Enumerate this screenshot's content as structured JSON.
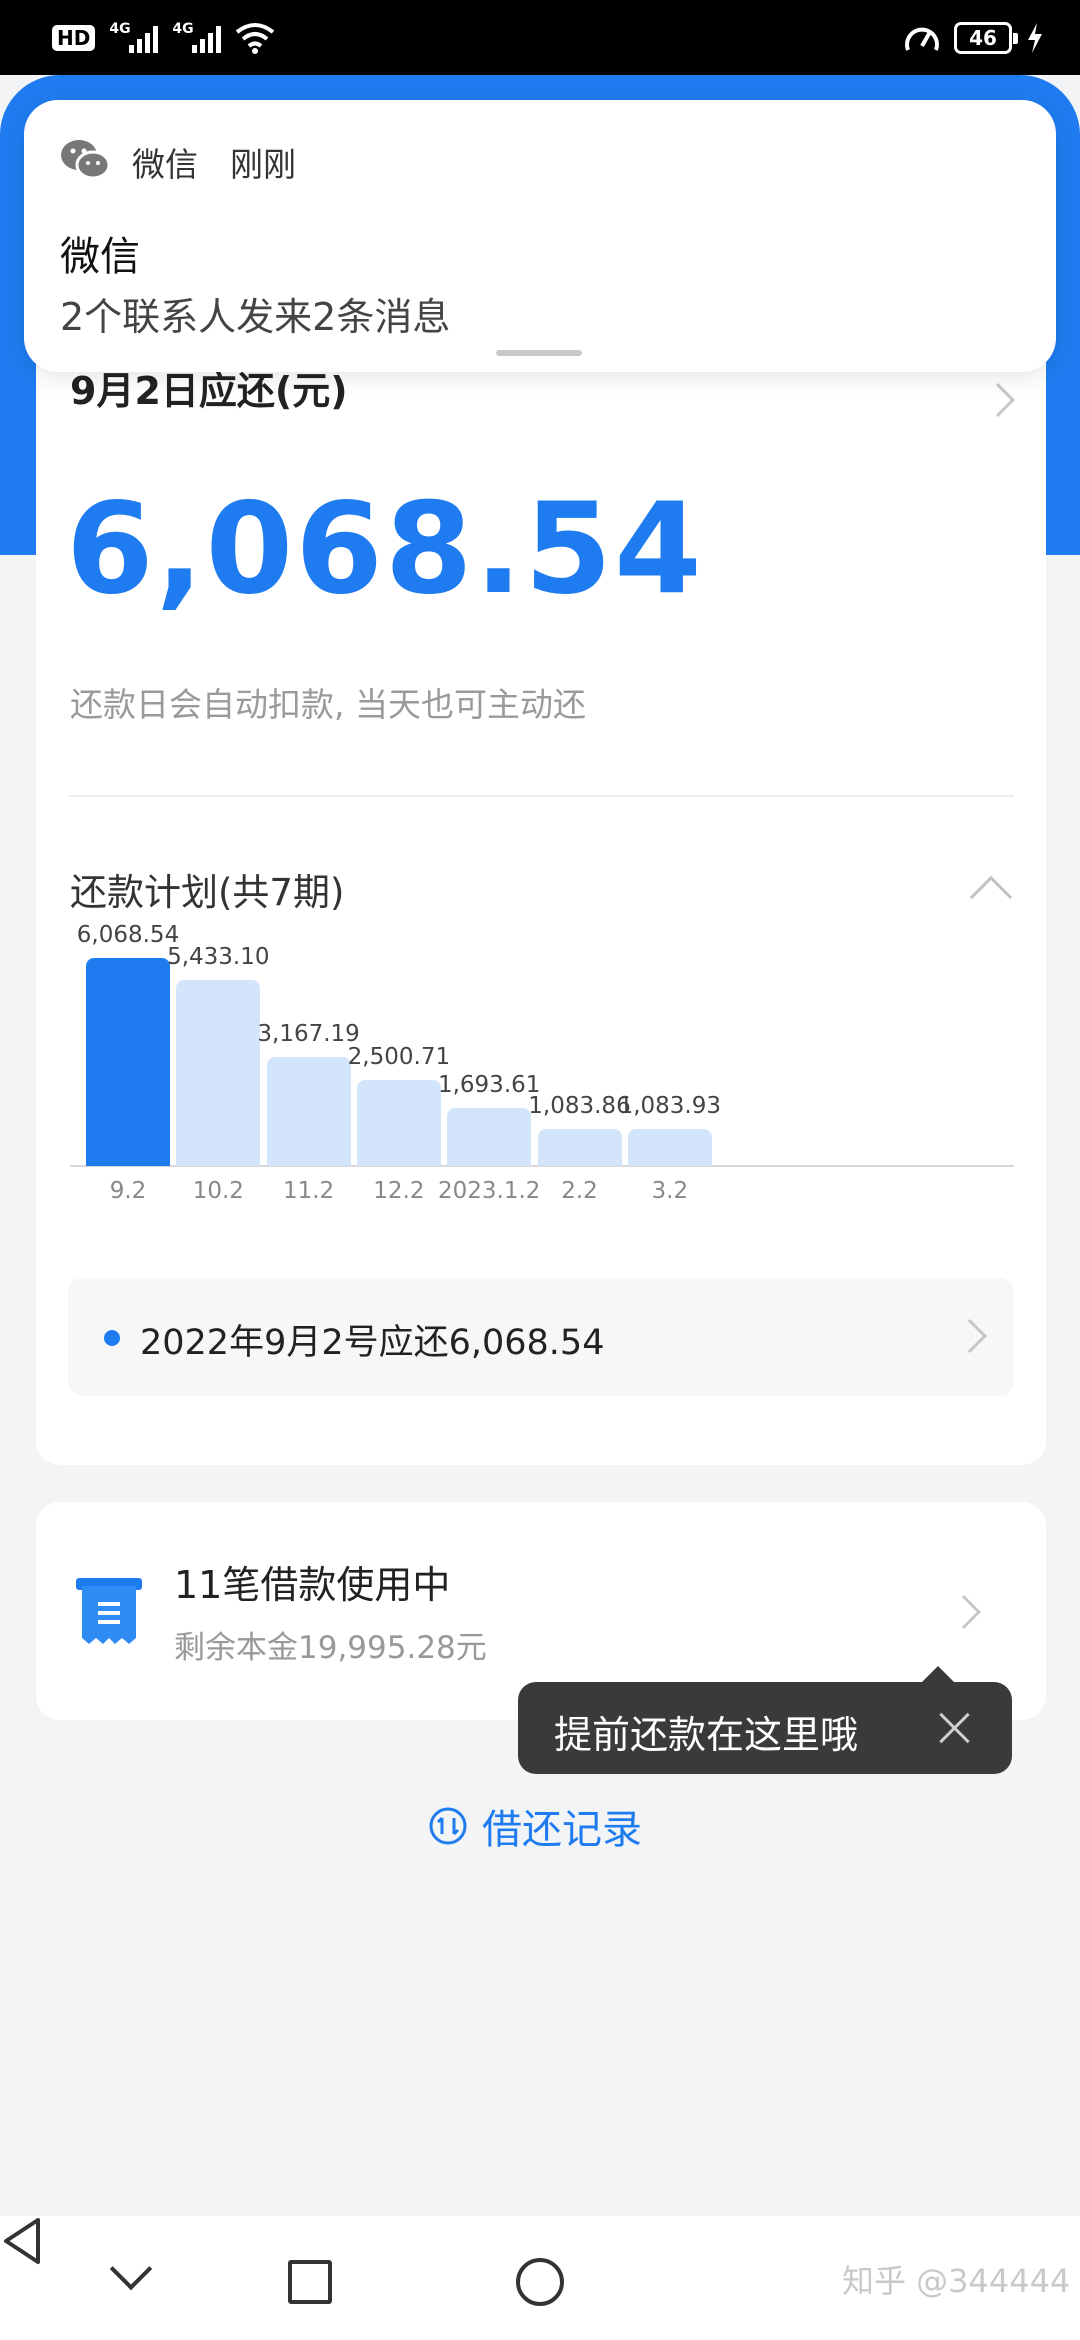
{
  "status_bar": {
    "hd_label": "HD",
    "network1": "4G",
    "network2": "4G",
    "battery": "46"
  },
  "notification": {
    "app_name": "微信",
    "time": "刚刚",
    "title": "微信",
    "body": "2个联系人发来2条消息"
  },
  "repayment": {
    "due_title": "9月2日应还(元)",
    "amount": "6,068.54",
    "note": "还款日会自动扣款, 当天也可主动还"
  },
  "plan": {
    "title": "还款计划(共7期)",
    "row_text": "2022年9月2号应还6,068.54"
  },
  "chart_data": {
    "type": "bar",
    "categories": [
      "9.2",
      "10.2",
      "11.2",
      "12.2",
      "2023.1.2",
      "2.2",
      "3.2"
    ],
    "values": [
      6068.54,
      5433.1,
      3167.19,
      2500.71,
      1693.61,
      1083.86,
      1083.93
    ],
    "value_labels": [
      "6,068.54",
      "5,433.10",
      "3,167.19",
      "2,500.71",
      "1,693.61",
      "1,083.86",
      "1,083.93"
    ],
    "highlight_index": 0,
    "ylim": [
      0,
      6068.54
    ],
    "colors": {
      "active": "#1f7cf0",
      "inactive": "#d3e5fb"
    }
  },
  "loan": {
    "title": "11笔借款使用中",
    "subtitle": "剩余本金19,995.28元"
  },
  "tooltip": {
    "text": "提前还款在这里哦"
  },
  "records": {
    "label": "借还记录"
  },
  "watermark": "知乎 @344444",
  "colors": {
    "accent": "#1f7cf0",
    "background": "#f3f4f6"
  }
}
